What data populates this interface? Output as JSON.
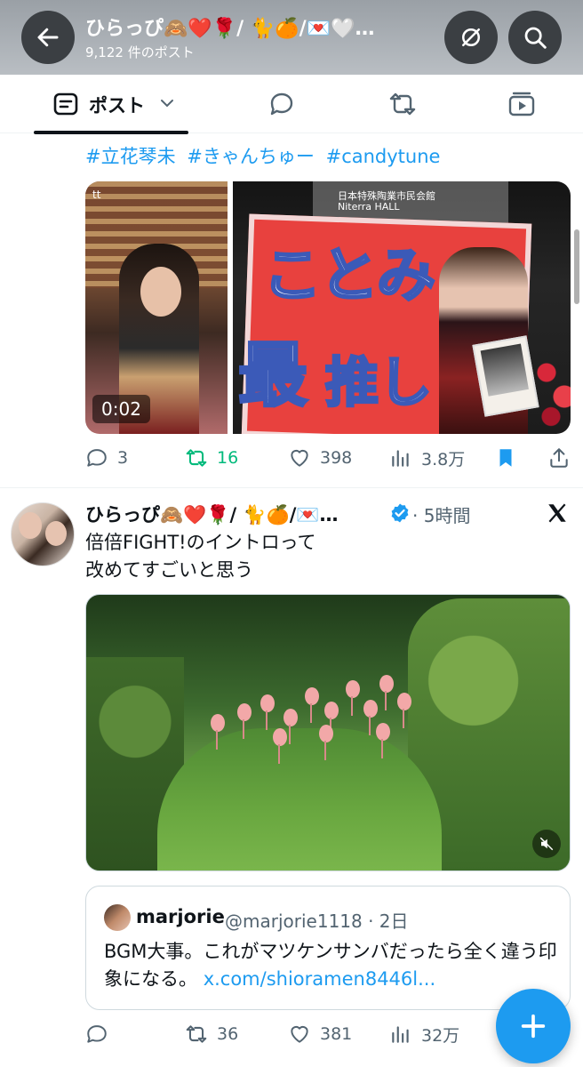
{
  "header": {
    "title": "ひらっぴ🙈❤️🌹/ 🐈🍊/💌🤍…",
    "post_count": "9,122 件のポスト"
  },
  "tabs": [
    {
      "label": "ポスト",
      "icon": "post-list-icon",
      "active": true
    },
    {
      "label": "",
      "icon": "reply-icon"
    },
    {
      "label": "",
      "icon": "repost-icon"
    },
    {
      "label": "",
      "icon": "media-icon"
    }
  ],
  "tweet1": {
    "hashtags": [
      "#立花琴未",
      "#きゃんちゅー",
      "#candytune"
    ],
    "video_duration": "0:02",
    "video_watermark": "tt",
    "image2_sign_text": {
      "line1": "ことみ",
      "line2a": "最",
      "line2b": "推し"
    },
    "image2_building_text": "Niterra HALL",
    "image2_building_text_jp": "日本特殊陶業市民会館",
    "replies": "3",
    "reposts": "16",
    "likes": "398",
    "views": "3.8万"
  },
  "tweet2": {
    "author": "ひらっぴ🙈❤️🌹/ 🐈🍊/💌…",
    "time": "· 5時間",
    "text_line1": "倍倍FIGHT!のイントロって",
    "text_line2": "改めてすごいと思う",
    "quote": {
      "name": "marjorie",
      "handle": "@marjorie1118 · 2日",
      "text": "BGM大事。これがマツケンサンバだったら全く違う印象になる。",
      "link": "x.com/shioramen8446l..."
    },
    "replies": "",
    "reposts": "36",
    "likes": "381",
    "views": "32万"
  },
  "colors": {
    "accent": "#1d9bf0",
    "repost_active": "#00ba7c",
    "text_secondary": "#536471"
  }
}
